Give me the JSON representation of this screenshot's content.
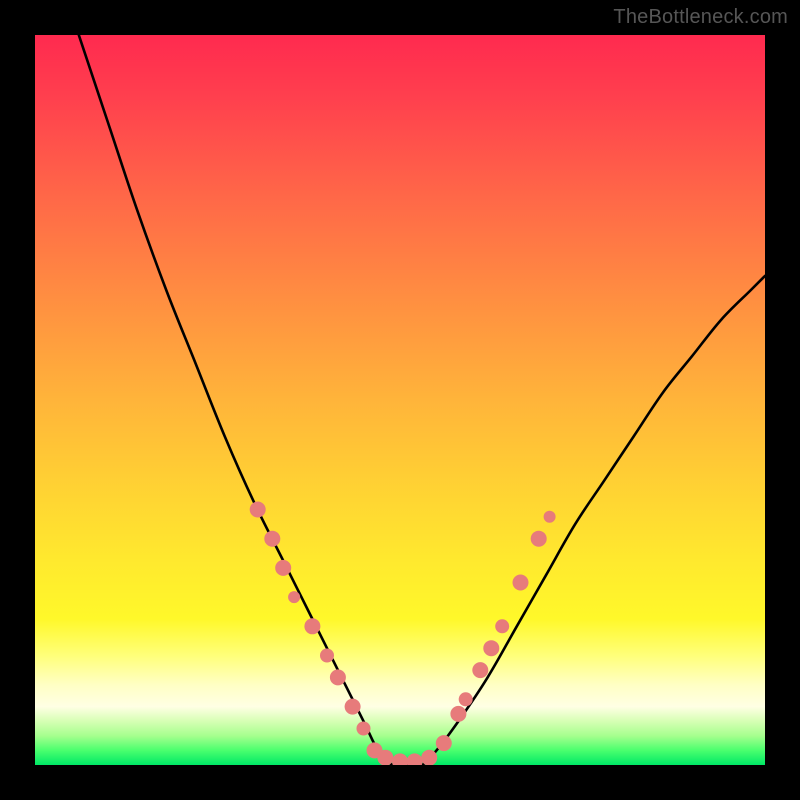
{
  "attribution": "TheBottleneck.com",
  "chart_data": {
    "type": "line",
    "title": "",
    "xlabel": "",
    "ylabel": "",
    "xlim": [
      0,
      100
    ],
    "ylim": [
      0,
      100
    ],
    "series": [
      {
        "name": "bottleneck-curve",
        "x": [
          6,
          10,
          14,
          18,
          22,
          26,
          30,
          34,
          38,
          42,
          45,
          47,
          49,
          51,
          53,
          55,
          58,
          62,
          66,
          70,
          74,
          78,
          82,
          86,
          90,
          94,
          98,
          100
        ],
        "y": [
          100,
          88,
          76,
          65,
          55,
          45,
          36,
          28,
          20,
          12,
          6,
          2,
          0,
          0,
          0,
          2,
          6,
          12,
          19,
          26,
          33,
          39,
          45,
          51,
          56,
          61,
          65,
          67
        ]
      }
    ],
    "markers": {
      "name": "highlighted-points",
      "color": "#e77b7b",
      "points": [
        {
          "x": 30.5,
          "y": 35,
          "r": 8
        },
        {
          "x": 32.5,
          "y": 31,
          "r": 8
        },
        {
          "x": 34.0,
          "y": 27,
          "r": 8
        },
        {
          "x": 35.5,
          "y": 23,
          "r": 6
        },
        {
          "x": 38.0,
          "y": 19,
          "r": 8
        },
        {
          "x": 40.0,
          "y": 15,
          "r": 7
        },
        {
          "x": 41.5,
          "y": 12,
          "r": 8
        },
        {
          "x": 43.5,
          "y": 8,
          "r": 8
        },
        {
          "x": 45.0,
          "y": 5,
          "r": 7
        },
        {
          "x": 46.5,
          "y": 2,
          "r": 8
        },
        {
          "x": 48.0,
          "y": 1,
          "r": 8
        },
        {
          "x": 50.0,
          "y": 0.5,
          "r": 8
        },
        {
          "x": 52.0,
          "y": 0.5,
          "r": 8
        },
        {
          "x": 54.0,
          "y": 1,
          "r": 8
        },
        {
          "x": 56.0,
          "y": 3,
          "r": 8
        },
        {
          "x": 58.0,
          "y": 7,
          "r": 8
        },
        {
          "x": 59.0,
          "y": 9,
          "r": 7
        },
        {
          "x": 61.0,
          "y": 13,
          "r": 8
        },
        {
          "x": 62.5,
          "y": 16,
          "r": 8
        },
        {
          "x": 64.0,
          "y": 19,
          "r": 7
        },
        {
          "x": 66.5,
          "y": 25,
          "r": 8
        },
        {
          "x": 69.0,
          "y": 31,
          "r": 8
        },
        {
          "x": 70.5,
          "y": 34,
          "r": 6
        }
      ]
    },
    "gradient_bands": [
      {
        "name": "red",
        "from_y": 100,
        "to_y": 60
      },
      {
        "name": "orange",
        "from_y": 60,
        "to_y": 30
      },
      {
        "name": "yellow",
        "from_y": 30,
        "to_y": 10
      },
      {
        "name": "green",
        "from_y": 10,
        "to_y": 0
      }
    ]
  }
}
